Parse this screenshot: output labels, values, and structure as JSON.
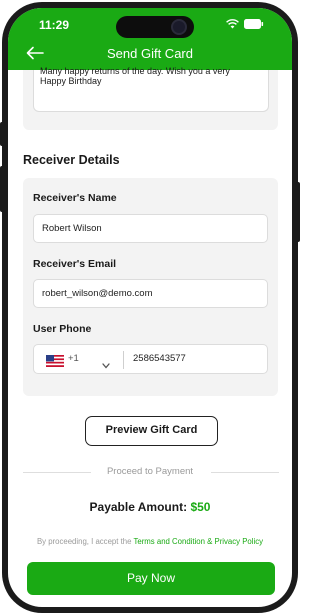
{
  "status_bar": {
    "time": "11:29"
  },
  "header": {
    "title": "Send Gift Card"
  },
  "message": {
    "partial_line": "Many happy returns of the day. Wish you a very",
    "text": "Happy Birthday"
  },
  "receiver": {
    "section_title": "Receiver Details",
    "name_label": "Receiver's Name",
    "name_value": "Robert Wilson",
    "email_label": "Receiver's Email",
    "email_value": "robert_wilson@demo.com",
    "phone_label": "User Phone",
    "dial_code": "+1",
    "phone_value": "2586543577"
  },
  "preview_button": "Preview Gift Card",
  "payment": {
    "divider_text": "Proceed to Payment",
    "payable_label": "Payable Amount:",
    "payable_amount": "$50",
    "terms_prefix": "By proceeding, I accept the",
    "terms_link": "Terms and Condition & Privacy Policy",
    "pay_button": "Pay Now"
  },
  "colors": {
    "brand_green": "#1aaa14",
    "card_bg": "#f3f3f3"
  }
}
